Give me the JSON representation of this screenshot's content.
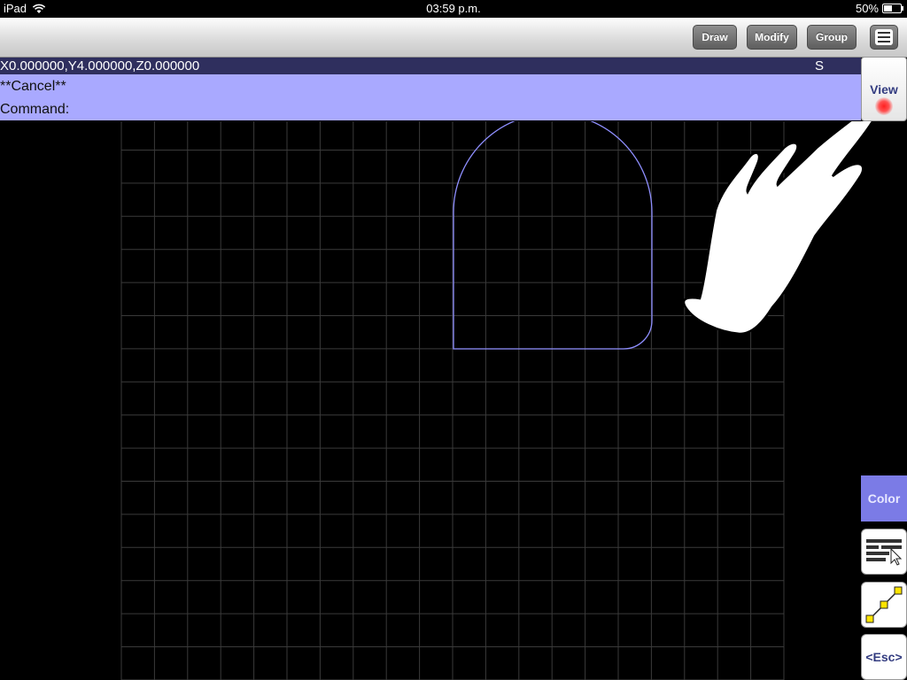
{
  "status_bar": {
    "device": "iPad",
    "time": "03:59 p.m.",
    "battery": "50%",
    "battery_level": 0.5
  },
  "toolbar": {
    "draw_label": "Draw",
    "modify_label": "Modify",
    "group_label": "Group"
  },
  "command": {
    "coordinates": "X0.000000,Y4.000000,Z0.000000",
    "snap_indicator": "S",
    "history_line": "**Cancel**",
    "prompt": "Command:"
  },
  "side_palette": {
    "view_label": "View",
    "color_label": "Color",
    "esc_label": "<Esc>"
  },
  "colors": {
    "background": "#000000",
    "grid": "#3a3a3a",
    "shape_stroke": "#8f8fff",
    "coord_bar": "#2f2f5e",
    "command_box": "#a9a9ff",
    "color_button": "#7b7be6"
  }
}
